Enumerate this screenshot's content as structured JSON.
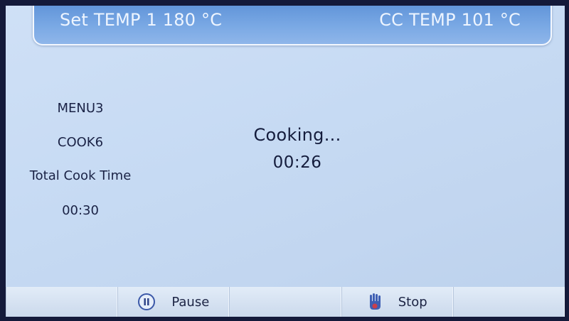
{
  "header": {
    "set_temp": "Set TEMP 1 180 °C",
    "cc_temp": "CC TEMP 101 °C"
  },
  "info": {
    "menu": "MENU3",
    "cook": "COOK6",
    "total_label": "Total Cook Time",
    "total_time": "00:30"
  },
  "status": {
    "label": "Cooking...",
    "remaining": "00:26"
  },
  "bottom_bar": {
    "pause_label": "Pause",
    "stop_label": "Stop"
  },
  "colors": {
    "header_bg": "#6b9ddd",
    "screen_bg": "#c6daf3",
    "text_dark": "#141c3c"
  },
  "icons": {
    "pause": "pause-icon",
    "stop": "stop-hand-icon"
  }
}
